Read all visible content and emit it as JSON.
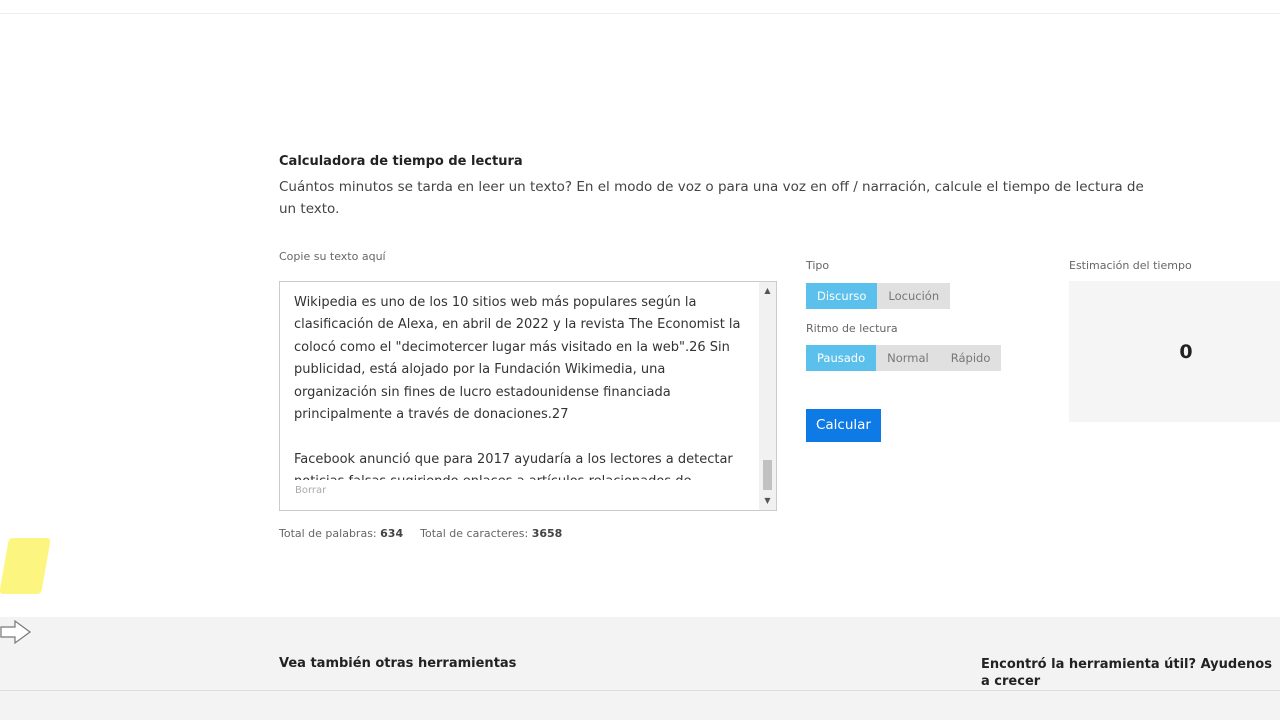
{
  "tool": {
    "title": "Calculadora de tiempo de lectura",
    "description": "Cuántos minutos se tarda en leer un texto? En el modo de voz o para una voz en off / narración, calcule el tiempo de lectura de un texto."
  },
  "input": {
    "label": "Copie su texto aquí",
    "paragraph1": "Wikipedia es uno de los 10 sitios web más populares según la clasificación de Alexa, en abril de 2022 y la revista The Economist la colocó como el \"decimotercer lugar más visitado en la web\".26 Sin publicidad, está alojado por la Fundación Wikimedia, una organización sin fines de lucro estadounidense financiada principalmente a través de donaciones.27",
    "paragraph2": "Facebook anunció que para 2017 ayudaría a los lectores a detectar noticias falsas sugiriendo enlaces a artículos relacionados de",
    "clear_label": "Borrar"
  },
  "counts": {
    "words_label": "Total de palabras:",
    "words_value": "634",
    "chars_label": "Total de caracteres:",
    "chars_value": "3658"
  },
  "type": {
    "label": "Tipo",
    "options": [
      "Discurso",
      "Locución"
    ],
    "selected": "Discurso"
  },
  "pace": {
    "label": "Ritmo de lectura",
    "options": [
      "Pausado",
      "Normal",
      "Rápido"
    ],
    "selected": "Pausado"
  },
  "calculate_label": "Calcular",
  "estimate": {
    "label": "Estimación del tiempo",
    "value": "0"
  },
  "footer": {
    "see_also": "Vea también otras herramientas",
    "help": "Encontró la herramienta útil? Ayudenos a crecer"
  },
  "colors": {
    "accent_active": "#5bc0eb",
    "primary_button": "#0d7ae6",
    "highlight_marker": "#fbf56a"
  },
  "icons": {
    "scroll_up": "triangle-up",
    "scroll_down": "triangle-down",
    "cursor": "hand-pointer-outline"
  }
}
